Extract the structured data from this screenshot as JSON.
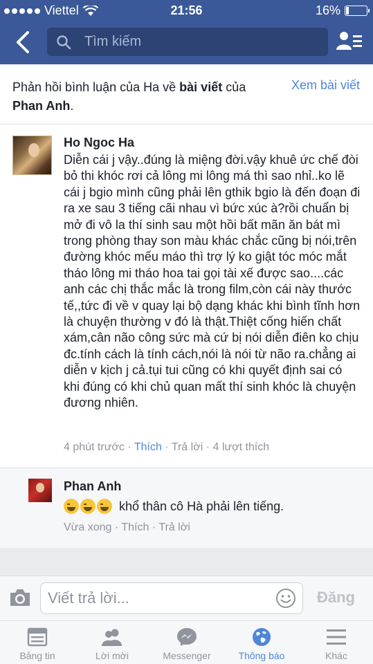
{
  "status_bar": {
    "carrier": "Viettel",
    "time": "21:56",
    "battery": "16%",
    "battery_level": 0.16
  },
  "nav": {
    "search_placeholder": "Tìm kiếm"
  },
  "context": {
    "text_prefix": "Phản hồi bình luận của Ha về ",
    "text_bold1": "bài viết",
    "text_mid": " của ",
    "text_bold2": "Phan Anh",
    "text_suffix": ".",
    "view_post": "Xem bài viết"
  },
  "comment": {
    "author": "Ho Ngoc Ha",
    "text": "Diễn cái j vậy..đúng là miệng đời.vậy khuê ức chế đòi bỏ thi khóc rơi cả lông mi lông má thì sao nhỉ..ko lẽ cái j bgio mình cũng phải lên gthik bgio là đến đoạn đi ra xe sau 3 tiếng cãi nhau vì bức xúc à?rồi chuẩn bị mở đi vô la thí sinh sau một hồi bất mãn ăn bát mì trong phòng thay son màu khác chắc cũng bị nói,trên đường khóc mếu máo thì trợ lý ko giật tóc móc mắt tháo lông mi tháo hoa tai gọi tài xế được sao....các anh các chị thắc mắc là trong film,còn cái này thước tế,,tức đi về v quay lại bộ dạng khác khi bình tĩnh hơn là chuyện thường v đó là thật.Thiệt cống hiến chất xám,cân não công sức mà cứ bị nói diễn điên ko chịu đc.tính cách là tính cách,nói là nói từ não ra.chẳng ai diễn v kịch j cả.tụi tui cũng có khi quyết định sai có khi đúng có khi chủ quan mất thí sinh khóc là chuyện đương nhiên.",
    "time": "4 phút trước",
    "like": "Thích",
    "reply": "Trả lời",
    "likes_count": "4 lượt thích",
    "sep": " · "
  },
  "reply": {
    "author": "Phan Anh",
    "text": "khổ thân cô Hà phải lên tiếng.",
    "emoji_count": 3,
    "time": "Vừa xong",
    "like": "Thích",
    "reply": "Trả lời",
    "sep": " · "
  },
  "composer": {
    "placeholder": "Viết trả lời...",
    "send": "Đăng"
  },
  "tabs": [
    {
      "label": "Bảng tin",
      "icon": "news-feed-icon"
    },
    {
      "label": "Lời mời",
      "icon": "friend-requests-icon"
    },
    {
      "label": "Messenger",
      "icon": "messenger-icon"
    },
    {
      "label": "Thông báo",
      "icon": "notifications-globe-icon",
      "active": true
    },
    {
      "label": "Khác",
      "icon": "more-menu-icon"
    }
  ],
  "colors": {
    "header": "#3b5998",
    "link": "#4e86d9",
    "meta": "#90949c"
  }
}
